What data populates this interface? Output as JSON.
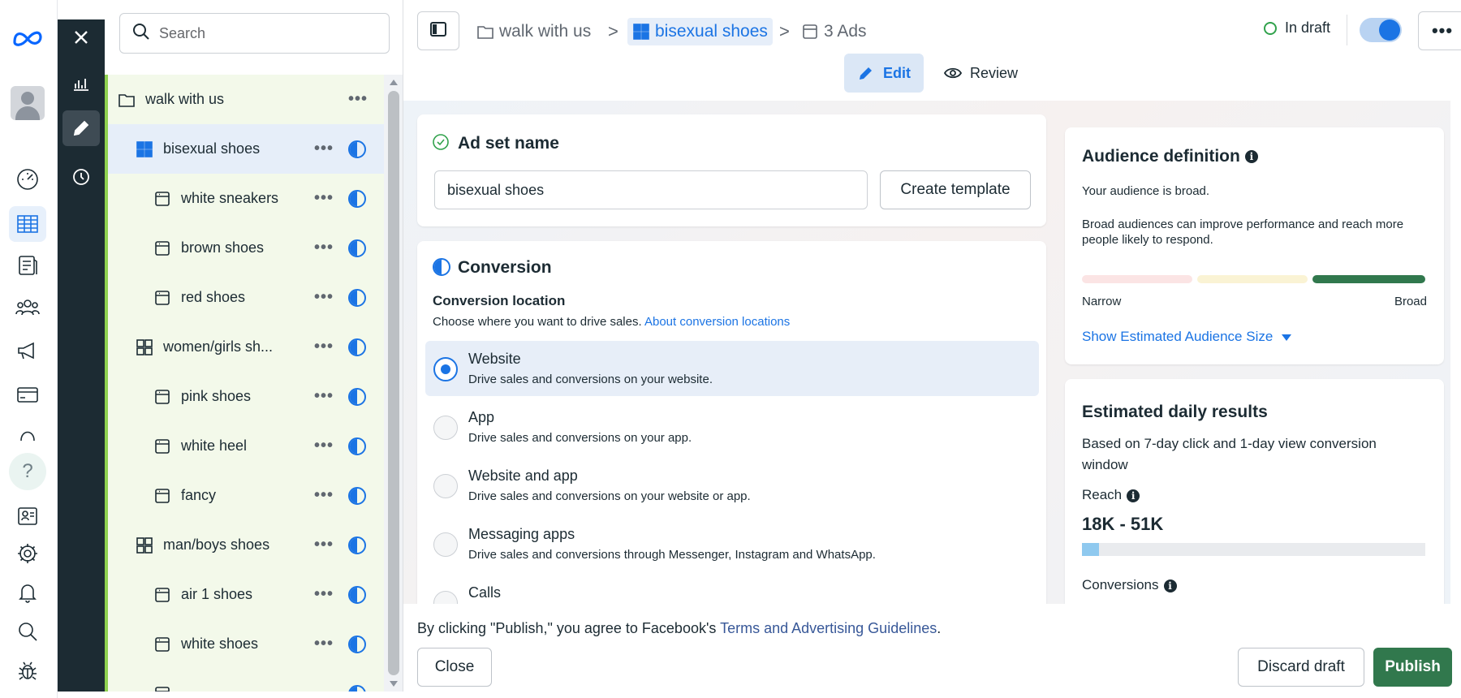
{
  "rail": {
    "items": [
      "meta-logo-icon",
      "avatar",
      "dashboard-icon",
      "campaigns-table-icon",
      "pages-icon",
      "audiences-icon",
      "ads-megaphone-icon",
      "billing-card-icon",
      "collapse-arc-icon",
      "help-icon",
      "news-icon",
      "settings-gear-icon",
      "notifications-bell-icon",
      "search-icon",
      "bug-report-icon"
    ],
    "help_label": "?"
  },
  "toolbar": {
    "close_label": "✕",
    "items": [
      "close-icon",
      "charts-icon",
      "edit-pencil-icon",
      "history-clock-icon"
    ]
  },
  "tree": {
    "search_placeholder": "Search",
    "items": [
      {
        "label": "walk with us",
        "type": "campaign",
        "more": "•••"
      },
      {
        "label": "bisexual shoes",
        "type": "adset",
        "more": "•••",
        "selected": true
      },
      {
        "label": "white sneakers",
        "type": "ad",
        "more": "•••"
      },
      {
        "label": "brown shoes",
        "type": "ad",
        "more": "•••"
      },
      {
        "label": "red shoes",
        "type": "ad",
        "more": "•••"
      },
      {
        "label": "women/girls sh...",
        "type": "adset",
        "more": "•••"
      },
      {
        "label": "pink shoes",
        "type": "ad",
        "more": "•••"
      },
      {
        "label": "white heel",
        "type": "ad",
        "more": "•••"
      },
      {
        "label": "fancy",
        "type": "ad",
        "more": "•••"
      },
      {
        "label": "man/boys shoes",
        "type": "adset",
        "more": "•••"
      },
      {
        "label": "air 1 shoes",
        "type": "ad",
        "more": "•••"
      },
      {
        "label": "white shoes",
        "type": "ad",
        "more": "•••"
      }
    ]
  },
  "header": {
    "breadcrumb": {
      "campaign": "walk with us",
      "adset": "bisexual shoes",
      "ads": "3 Ads",
      "separator": ">"
    },
    "status": "In draft",
    "more": "•••",
    "modes": {
      "edit": "Edit",
      "review": "Review"
    }
  },
  "adset_name": {
    "title": "Ad set name",
    "value": "bisexual shoes",
    "template_button": "Create template"
  },
  "conversion": {
    "title": "Conversion",
    "location_label": "Conversion location",
    "location_desc": "Choose where you want to drive sales.",
    "location_link": "About conversion locations",
    "options": [
      {
        "title": "Website",
        "desc": "Drive sales and conversions on your website.",
        "selected": true
      },
      {
        "title": "App",
        "desc": "Drive sales and conversions on your app."
      },
      {
        "title": "Website and app",
        "desc": "Drive sales and conversions on your website or app."
      },
      {
        "title": "Messaging apps",
        "desc": "Drive sales and conversions through Messenger, Instagram and WhatsApp."
      },
      {
        "title": "Calls",
        "desc": ""
      }
    ]
  },
  "audience": {
    "title": "Audience definition",
    "broad_text": "Your audience is broad.",
    "broad_desc": "Broad audiences can improve performance and reach more people likely to respond.",
    "narrow_label": "Narrow",
    "broad_label": "Broad",
    "show_size_link": "Show Estimated Audience Size",
    "level": "broad"
  },
  "estimates": {
    "title": "Estimated daily results",
    "desc": "Based on 7-day click and 1-day view conversion window",
    "reach_label": "Reach",
    "reach_value": "18K - 51K",
    "reach_fill": 0.05,
    "conversions_label": "Conversions"
  },
  "footer": {
    "agree_prefix": "By clicking \"Publish,\" you agree to Facebook's",
    "agree_link": "Terms and Advertising Guidelines",
    "agree_suffix": ".",
    "close_button": "Close",
    "discard_button": "Discard draft",
    "publish_button": "Publish"
  },
  "colors": {
    "accent": "#1b74e4",
    "publish": "#31784d",
    "draft_status": "#31a24c",
    "tree_highlight": "#8fd14f",
    "audience_broad": "#31784d"
  }
}
